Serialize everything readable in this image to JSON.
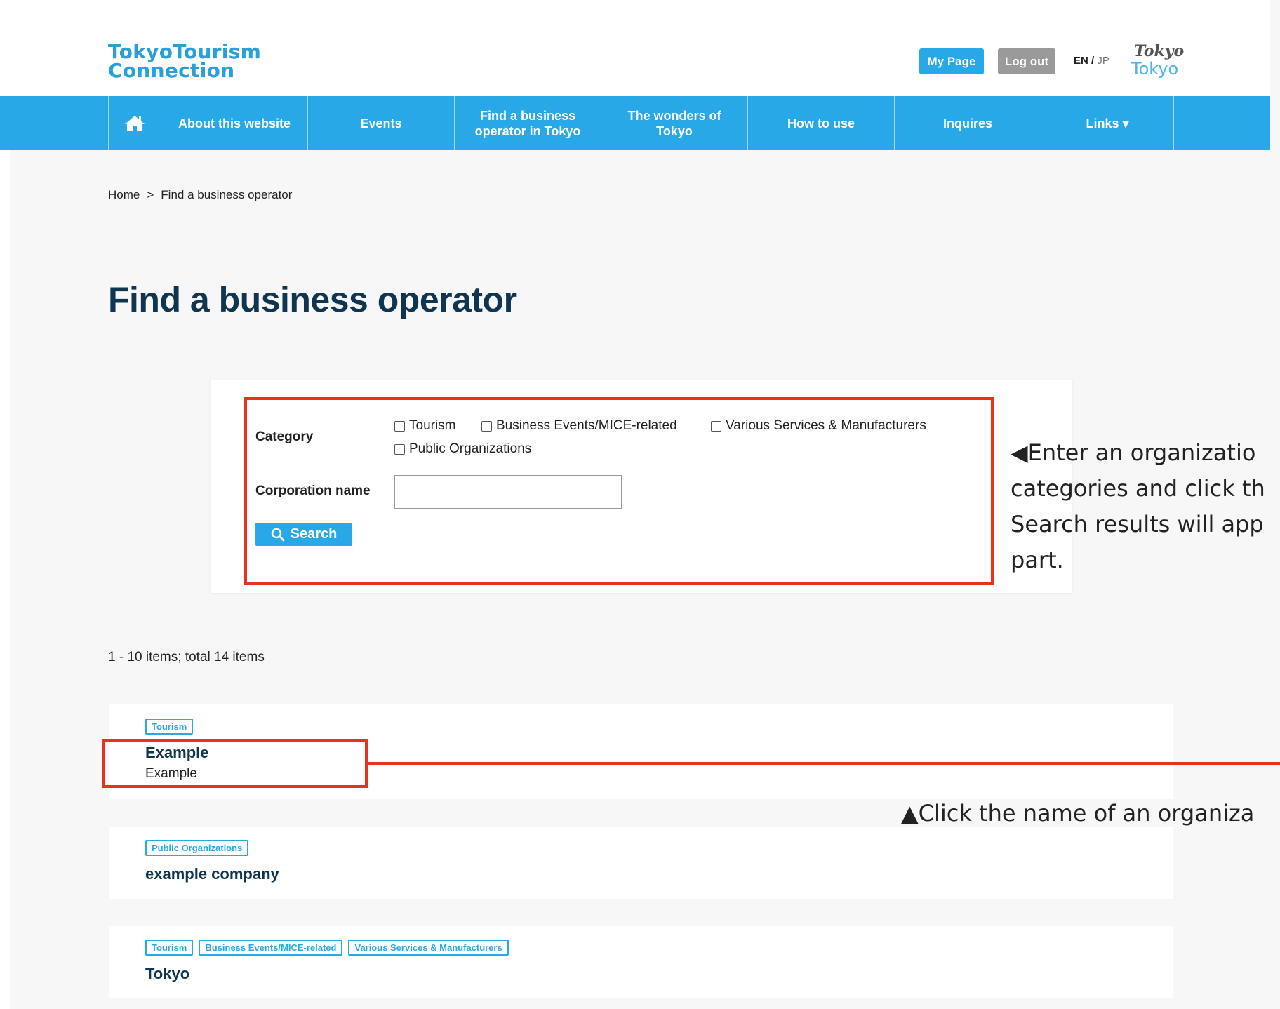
{
  "header": {
    "logo_line1": "TokyoTourism",
    "logo_line2": "Connection",
    "mypage_label": "My Page",
    "logout_label": "Log out",
    "lang_en": "EN",
    "lang_sep": "/",
    "lang_jp": "JP",
    "tokyo_logo_line1": "Tokyo",
    "tokyo_logo_line2": "Tokyo"
  },
  "nav": {
    "home_icon": "home-icon",
    "items": [
      {
        "label": "About this website"
      },
      {
        "label": "Events"
      },
      {
        "label": "Find a business operator in Tokyo"
      },
      {
        "label": "The wonders of Tokyo"
      },
      {
        "label": "How to use"
      },
      {
        "label": "Inquires"
      },
      {
        "label": "Links ▾"
      }
    ]
  },
  "breadcrumb": {
    "home": "Home",
    "separator": ">",
    "current": "Find a business operator"
  },
  "page_title": "Find a business operator",
  "search": {
    "category_label": "Category",
    "categories": [
      {
        "label": "Tourism",
        "checked": false
      },
      {
        "label": "Business Events/MICE-related",
        "checked": false
      },
      {
        "label": "Various Services & Manufacturers",
        "checked": false
      },
      {
        "label": "Public Organizations",
        "checked": false
      }
    ],
    "corp_label": "Corporation name",
    "corp_value": "",
    "search_label": "Search"
  },
  "annotations": {
    "search_help": "◀Enter an organizatio\ncategories and click th\nSearch results will app\npart.",
    "result_help": "▲Click the name of an organiza"
  },
  "results_count": "1 - 10 items; total 14 items",
  "results": [
    {
      "tags": [
        "Tourism"
      ],
      "name": "Example",
      "sub": "Example"
    },
    {
      "tags": [
        "Public Organizations"
      ],
      "name": "example company",
      "sub": ""
    },
    {
      "tags": [
        "Tourism",
        "Business Events/MICE-related",
        "Various Services & Manufacturers"
      ],
      "name": "Tokyo",
      "sub": ""
    }
  ],
  "colors": {
    "brand_blue": "#29a8e8",
    "title_navy": "#0f3550",
    "highlight_red": "#e8321e",
    "logout_gray": "#9a9a9a"
  }
}
